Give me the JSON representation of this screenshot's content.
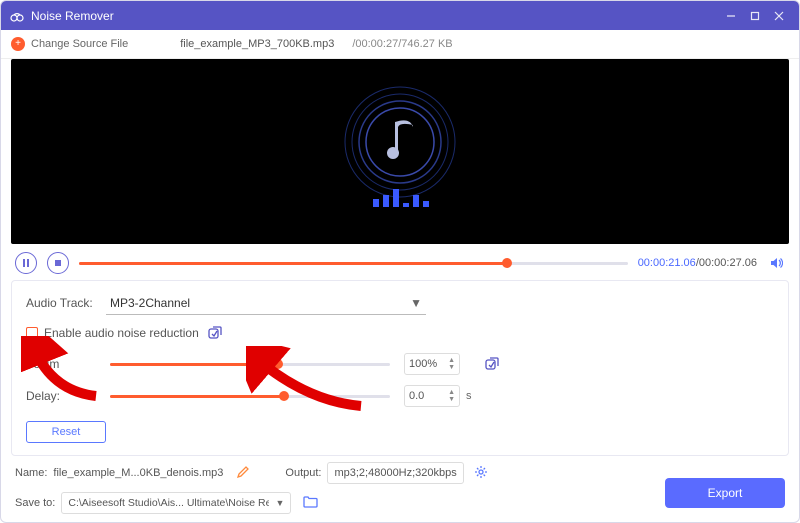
{
  "titlebar": {
    "app_name": "Noise Remover"
  },
  "filebar": {
    "change_source_label": "Change Source File",
    "filename": "file_example_MP3_700KB.mp3",
    "stats": "/00:00:27/746.27 KB"
  },
  "transport": {
    "current_time": "00:00:21.06",
    "total_time": "00:00:27.06",
    "progress_pct": 78
  },
  "panel": {
    "audio_track_label": "Audio Track:",
    "audio_track_value": "MP3-2Channel",
    "enable_noise_label": "Enable audio noise reduction",
    "volume_label": "Volum",
    "volume_value": "100%",
    "volume_pct": 60,
    "delay_label": "Delay:",
    "delay_value": "0.0",
    "delay_unit": "s",
    "delay_pct": 62,
    "reset_label": "Reset"
  },
  "footer": {
    "name_label": "Name:",
    "name_value": "file_example_M...0KB_denois.mp3",
    "output_label": "Output:",
    "output_value": "mp3;2;48000Hz;320kbps",
    "save_to_label": "Save to:",
    "save_to_value": "C:\\Aiseesoft Studio\\Ais... Ultimate\\Noise Remover",
    "export_label": "Export"
  }
}
